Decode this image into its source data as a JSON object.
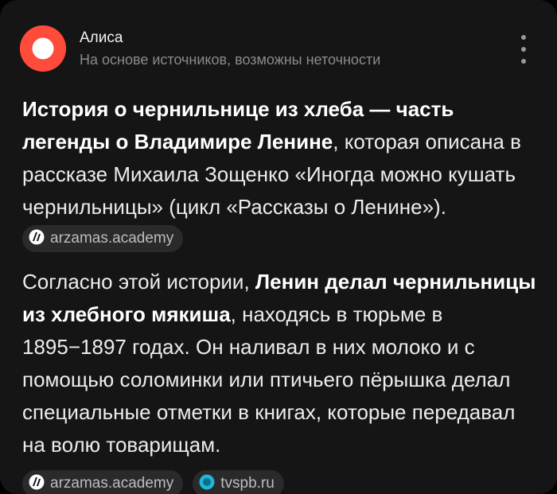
{
  "header": {
    "name": "Алиса",
    "subtitle": "На основе источников, возможны неточности"
  },
  "answer": {
    "p1": {
      "bold": "История о чернильнице из хлеба — часть легенды о Владимире Ленине",
      "text": ", которая описана в рассказе Михаила Зощенко «Иногда можно кушать чернильницы» (цикл «Рассказы о Ленине»).",
      "source": "arzamas.academy"
    },
    "p2": {
      "lead": "Согласно этой истории, ",
      "bold": "Ленин делал чернильницы из хлебного мякиша",
      "text": ", находясь в тюрьме в 1895−1897 годах. Он наливал в них молоко и с помощью соломинки или птичьего пёрышка делал специальные отметки в книгах, которые передавал на волю товарищам."
    },
    "sources": [
      {
        "label": "arzamas.academy",
        "icon": "arzamas-logo-icon"
      },
      {
        "label": "tvspb.ru",
        "icon": "tvspb-logo-icon"
      }
    ]
  },
  "colors": {
    "background": "#151515",
    "accent": "#ff4b3a",
    "chip": "#2a2a2a"
  }
}
